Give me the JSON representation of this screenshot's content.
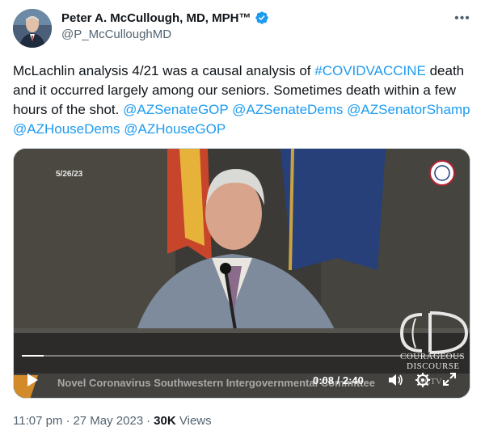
{
  "author": {
    "display_name": "Peter A. McCullough, MD, MPH™",
    "handle": "@P_McCulloughMD",
    "verified": true
  },
  "tweet": {
    "text_plain_1": "McLachlin analysis 4/21 was a causal analysis of ",
    "hashtag": "#COVIDVACCINE",
    "text_plain_2": " death and it occurred largely among our seniors.  Sometimes death within a few hours of the shot.  ",
    "mentions": [
      "@AZSenateGOP",
      "@AZSenateDems",
      "@AZSenatorShamp",
      "@AZHouseDems",
      "@AZHouseGOP"
    ]
  },
  "video": {
    "date_stamp": "5/26/23",
    "caption": "Novel Coronavirus Southwestern Intergovernmental Committee",
    "logo_line1": "COURAGEOUS",
    "logo_line2": "DISCOURSE",
    "logo_line3": "ACTV",
    "time_display": "0:08 / 2:40",
    "progress": 0.05
  },
  "meta": {
    "time": "11:07 pm",
    "date": "27 May 2023",
    "views_count": "30K",
    "views_label": "Views",
    "separator": "·"
  },
  "colors": {
    "link": "#1d9bf0",
    "secondary_text": "#536471",
    "verified_badge": "#1d9bf0"
  }
}
